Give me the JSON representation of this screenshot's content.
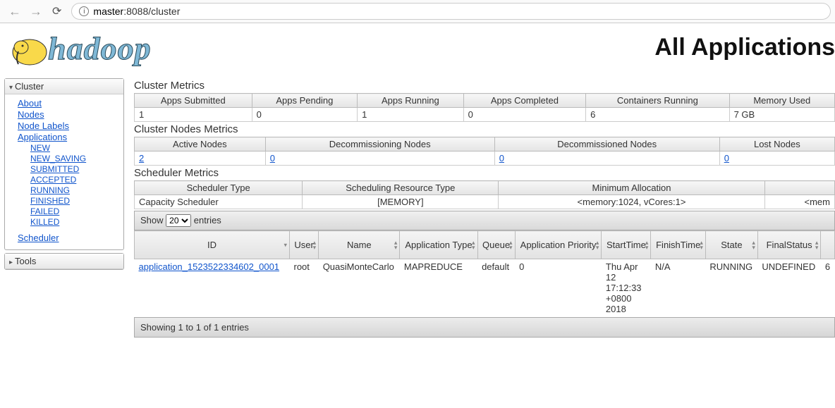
{
  "browser": {
    "url_prefix": "ⓘ",
    "url_host": "master",
    "url_path": ":8088/cluster"
  },
  "page": {
    "title": "All Applications",
    "logo_text": "hadoop"
  },
  "sidebar": {
    "cluster": {
      "header": "Cluster",
      "items": [
        {
          "label": "About"
        },
        {
          "label": "Nodes"
        },
        {
          "label": "Node Labels"
        },
        {
          "label": "Applications"
        }
      ],
      "app_sub": [
        {
          "label": "NEW"
        },
        {
          "label": "NEW_SAVING"
        },
        {
          "label": "SUBMITTED"
        },
        {
          "label": "ACCEPTED"
        },
        {
          "label": "RUNNING"
        },
        {
          "label": "FINISHED"
        },
        {
          "label": "FAILED"
        },
        {
          "label": "KILLED"
        }
      ],
      "scheduler": "Scheduler"
    },
    "tools": {
      "header": "Tools"
    }
  },
  "cluster_metrics": {
    "title": "Cluster Metrics",
    "headers": [
      "Apps Submitted",
      "Apps Pending",
      "Apps Running",
      "Apps Completed",
      "Containers Running",
      "Memory Used"
    ],
    "values": [
      "1",
      "0",
      "1",
      "0",
      "6",
      "7 GB"
    ]
  },
  "nodes_metrics": {
    "title": "Cluster Nodes Metrics",
    "headers": [
      "Active Nodes",
      "Decommissioning Nodes",
      "Decommissioned Nodes",
      "Lost Nodes"
    ],
    "values": [
      "2",
      "0",
      "0",
      "0"
    ]
  },
  "scheduler_metrics": {
    "title": "Scheduler Metrics",
    "headers": [
      "Scheduler Type",
      "Scheduling Resource Type",
      "Minimum Allocation",
      ""
    ],
    "values": [
      "Capacity Scheduler",
      "[MEMORY]",
      "<memory:1024, vCores:1>",
      "<mem"
    ]
  },
  "apps_toolbar": {
    "show": "Show",
    "page_size": "20",
    "entries": "entries"
  },
  "apps_table": {
    "headers": [
      "ID",
      "User",
      "Name",
      "Application Type",
      "Queue",
      "Application Priority",
      "StartTime",
      "FinishTime",
      "State",
      "FinalStatus",
      ""
    ],
    "row": {
      "id": "application_1523522334602_0001",
      "user": "root",
      "name": "QuasiMonteCarlo",
      "type": "MAPREDUCE",
      "queue": "default",
      "priority": "0",
      "start": "Thu Apr 12 17:12:33 +0800 2018",
      "finish": "N/A",
      "state": "RUNNING",
      "final": "UNDEFINED",
      "extra": "6"
    }
  },
  "footer": "Showing 1 to 1 of 1 entries"
}
